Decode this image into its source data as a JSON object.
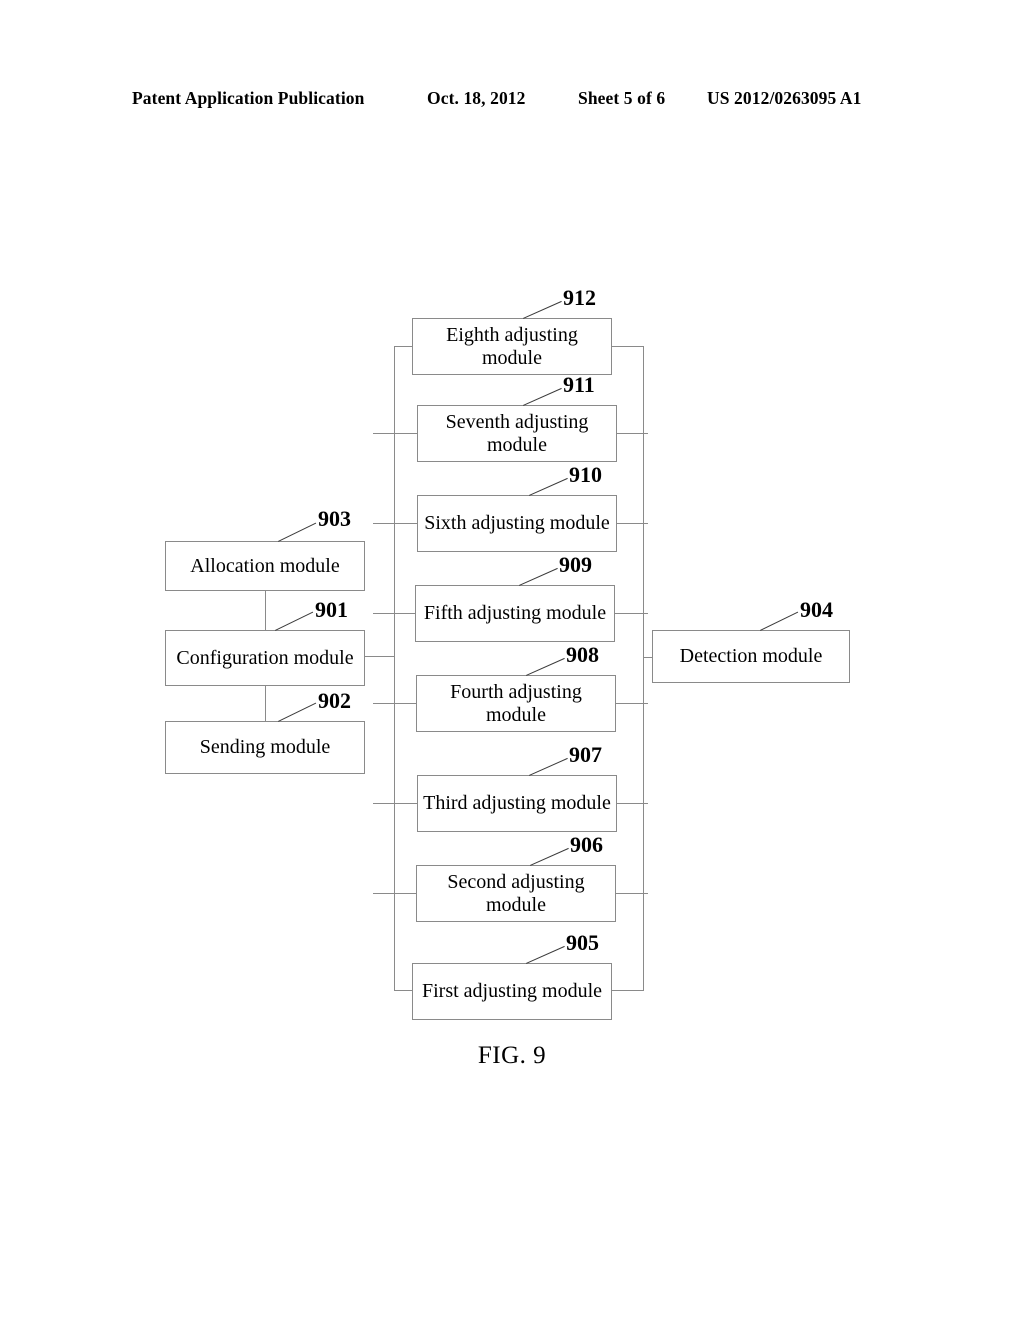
{
  "header": {
    "publication": "Patent Application Publication",
    "date": "Oct. 18, 2012",
    "sheet": "Sheet 5 of 6",
    "patent_number": "US 2012/0263095 A1"
  },
  "figure": {
    "caption": "FIG. 9",
    "nodes": [
      {
        "id": "n912",
        "ref": "912",
        "label": "Eighth adjusting module"
      },
      {
        "id": "n911",
        "ref": "911",
        "label": "Seventh adjusting module"
      },
      {
        "id": "n910",
        "ref": "910",
        "label": "Sixth adjusting module"
      },
      {
        "id": "n909",
        "ref": "909",
        "label": "Fifth adjusting module"
      },
      {
        "id": "n908",
        "ref": "908",
        "label": "Fourth adjusting module"
      },
      {
        "id": "n907",
        "ref": "907",
        "label": "Third adjusting module"
      },
      {
        "id": "n906",
        "ref": "906",
        "label": "Second adjusting module"
      },
      {
        "id": "n905",
        "ref": "905",
        "label": "First adjusting module"
      },
      {
        "id": "n903",
        "ref": "903",
        "label": "Allocation module"
      },
      {
        "id": "n901",
        "ref": "901",
        "label": "Configuration module"
      },
      {
        "id": "n902",
        "ref": "902",
        "label": "Sending module"
      },
      {
        "id": "n904",
        "ref": "904",
        "label": "Detection module"
      }
    ]
  }
}
